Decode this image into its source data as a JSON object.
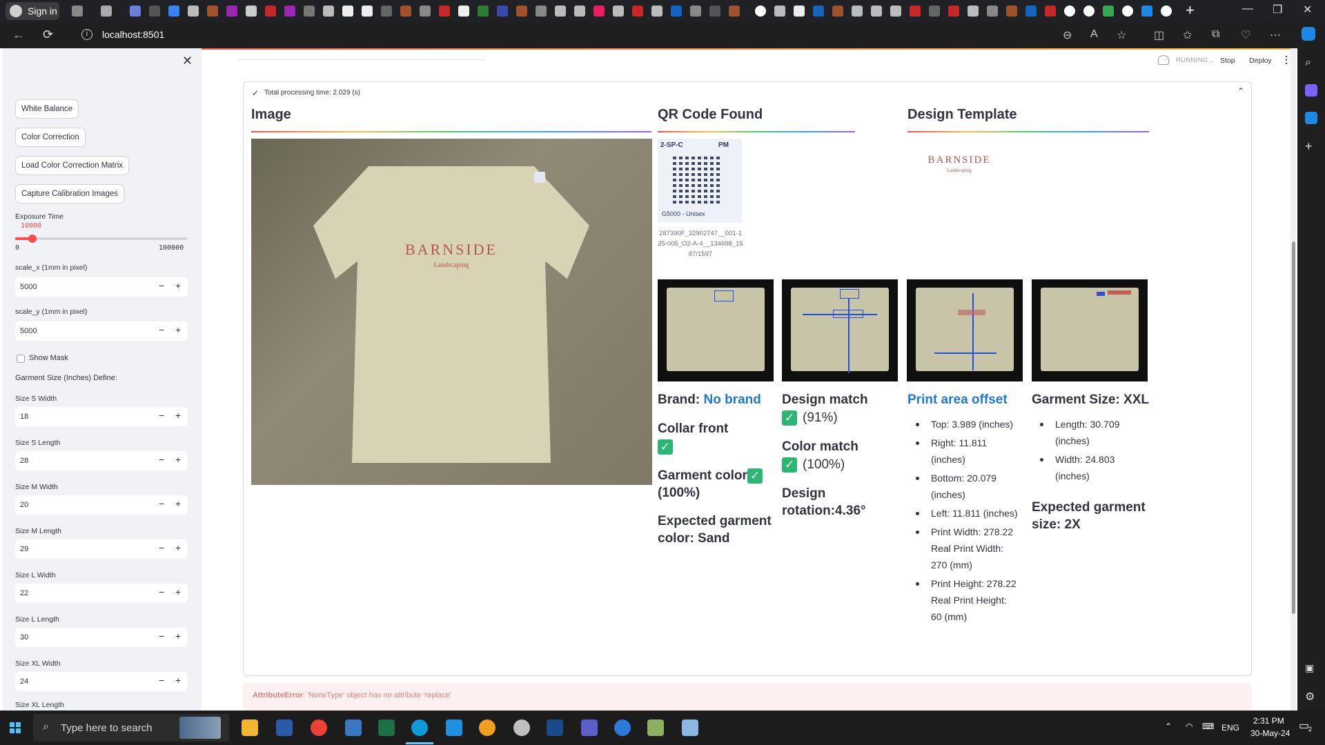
{
  "browser": {
    "signin_label": "Sign in",
    "url": "localhost:8501"
  },
  "colors": {
    "accent_red": "#ff4b4b",
    "link_blue": "#1f77d4",
    "check_green": "#2bb673",
    "sidebar_bg": "#f0f2f6"
  },
  "header": {
    "status": "RUNNING...",
    "stop_label": "Stop",
    "deploy_label": "Deploy"
  },
  "sidebar": {
    "buttons": {
      "white_balance": "White Balance",
      "color_correction": "Color Correction",
      "load_ccm": "Load Color Correction Matrix",
      "capture_calib": "Capture Calibration Images"
    },
    "exposure": {
      "label": "Exposure Time",
      "value": "10000",
      "min": "0",
      "max": "100000",
      "fraction": 0.1
    },
    "scale_x": {
      "label": "scale_x (1mm in pixel)",
      "value": "5000"
    },
    "scale_y": {
      "label": "scale_y (1mm in pixel)",
      "value": "5000"
    },
    "show_mask": "Show Mask",
    "garment_define": "Garment Size (Inches) Define:",
    "sizes": [
      {
        "label": "Size S Width",
        "value": "18"
      },
      {
        "label": "Size S Length",
        "value": "28"
      },
      {
        "label": "Size M Width",
        "value": "20"
      },
      {
        "label": "Size M Length",
        "value": "29"
      },
      {
        "label": "Size L Width",
        "value": "22"
      },
      {
        "label": "Size L Length",
        "value": "30"
      },
      {
        "label": "Size XL Width",
        "value": "24"
      },
      {
        "label": "Size XL Length",
        "value": ""
      }
    ]
  },
  "panel": {
    "processing": "Total processing time: 2.029 (s)",
    "image_title": "Image",
    "qr_title": "QR Code Found",
    "template_title": "Design Template",
    "qr_top": "2-SP-C",
    "qr_top_right": "PM",
    "qr_bottom": "G5000 - Unisex",
    "qr_caption": "287390F_32902747__001-125-005_O2-A-4__134698_1587/1597",
    "logo_main": "BARNSIDE",
    "logo_sub": "Landscaping",
    "brand_label": "Brand: ",
    "brand_value": "No brand",
    "collar_front": "Collar front",
    "garment_color_label": "Garment color:",
    "garment_color_pct": "(100%)",
    "expected_color": "Expected garment color: Sand",
    "design_match": "Design match",
    "design_match_pct": "(91%)",
    "color_match": "Color match",
    "color_match_pct": "(100%)",
    "design_rotation": "Design rotation:4.36°",
    "offset_title": "Print area offset",
    "offset_items": [
      "Top: 3.989 (inches)",
      "Right: 11.811 (inches)",
      "Bottom: 20.079 (inches)",
      "Left: 11.811 (inches)",
      "Print Width: 278.22 Real Print Width: 270 (mm)",
      "Print Height: 278.22 Real Print Height: 60 (mm)"
    ],
    "garment_size": "Garment Size: XXL",
    "size_items": [
      "Length: 30.709 (inches)",
      "Width: 24.803 (inches)"
    ],
    "expected_size": "Expected garment size: 2X"
  },
  "error": {
    "type": "AttributeError",
    "message": ": 'NoneType' object has no attribute 'replace'"
  },
  "taskbar": {
    "search_placeholder": "Type here to search",
    "lang": "ENG",
    "time": "2:31 PM",
    "date": "30-May-24",
    "notif_count": "2"
  }
}
